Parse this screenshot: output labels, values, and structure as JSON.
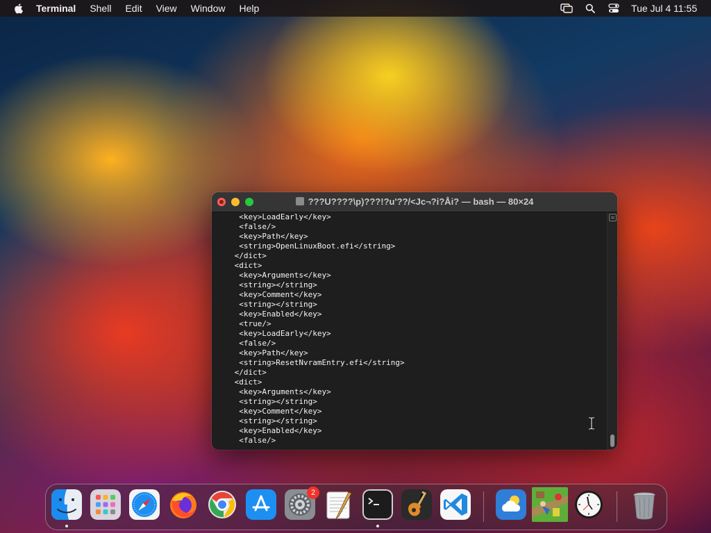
{
  "menubar": {
    "app_name": "Terminal",
    "items": [
      "Shell",
      "Edit",
      "View",
      "Window",
      "Help"
    ],
    "clock": "Tue Jul 4  11:55",
    "tray_icons": [
      "screen-mirroring-icon",
      "search-icon",
      "control-center-icon"
    ]
  },
  "window": {
    "title": "???U????\\p)???!?u'??/<Jc¬?i?Åi? — bash — 80×24",
    "lines": [
      "  <key>LoadEarly</key>",
      "  <false/>",
      "  <key>Path</key>",
      "  <string>OpenLinuxBoot.efi</string>",
      " </dict>",
      " <dict>",
      "  <key>Arguments</key>",
      "  <string></string>",
      "  <key>Comment</key>",
      "  <string></string>",
      "  <key>Enabled</key>",
      "  <true/>",
      "  <key>LoadEarly</key>",
      "  <false/>",
      "  <key>Path</key>",
      "  <string>ResetNvramEntry.efi</string>",
      " </dict>",
      " <dict>",
      "  <key>Arguments</key>",
      "  <string></string>",
      "  <key>Comment</key>",
      "  <string></string>",
      "  <key>Enabled</key>",
      "  <false/>"
    ]
  },
  "dock": {
    "apps": [
      {
        "name": "Finder",
        "icon": "finder-icon",
        "running": true
      },
      {
        "name": "Launchpad",
        "icon": "launchpad-icon",
        "running": false
      },
      {
        "name": "Safari",
        "icon": "safari-icon",
        "running": false
      },
      {
        "name": "Firefox",
        "icon": "firefox-icon",
        "running": false
      },
      {
        "name": "Google Chrome",
        "icon": "chrome-icon",
        "running": false
      },
      {
        "name": "App Store",
        "icon": "app-store-icon",
        "running": false
      },
      {
        "name": "System Settings",
        "icon": "system-settings-icon",
        "running": false,
        "badge": "2"
      },
      {
        "name": "TextEdit",
        "icon": "textedit-icon",
        "running": false
      },
      {
        "name": "Terminal",
        "icon": "terminal-icon",
        "running": true
      },
      {
        "name": "GarageBand",
        "icon": "garageband-icon",
        "running": false
      },
      {
        "name": "Visual Studio Code",
        "icon": "vscode-icon",
        "running": false
      },
      {
        "name": "Weather",
        "icon": "weather-icon",
        "running": false
      },
      {
        "name": "Game",
        "icon": "game-icon",
        "running": false
      },
      {
        "name": "Clock",
        "icon": "clock-icon",
        "running": false
      },
      {
        "name": "Trash",
        "icon": "trash-icon",
        "running": false
      }
    ]
  },
  "colors": {
    "menubar_bg": "#1e1614",
    "terminal_bg": "#1e1e1e",
    "titlebar_bg": "#353535",
    "close": "#fe5f57",
    "minimize": "#febc2e",
    "zoom": "#28c840",
    "badge": "#f0332a"
  }
}
